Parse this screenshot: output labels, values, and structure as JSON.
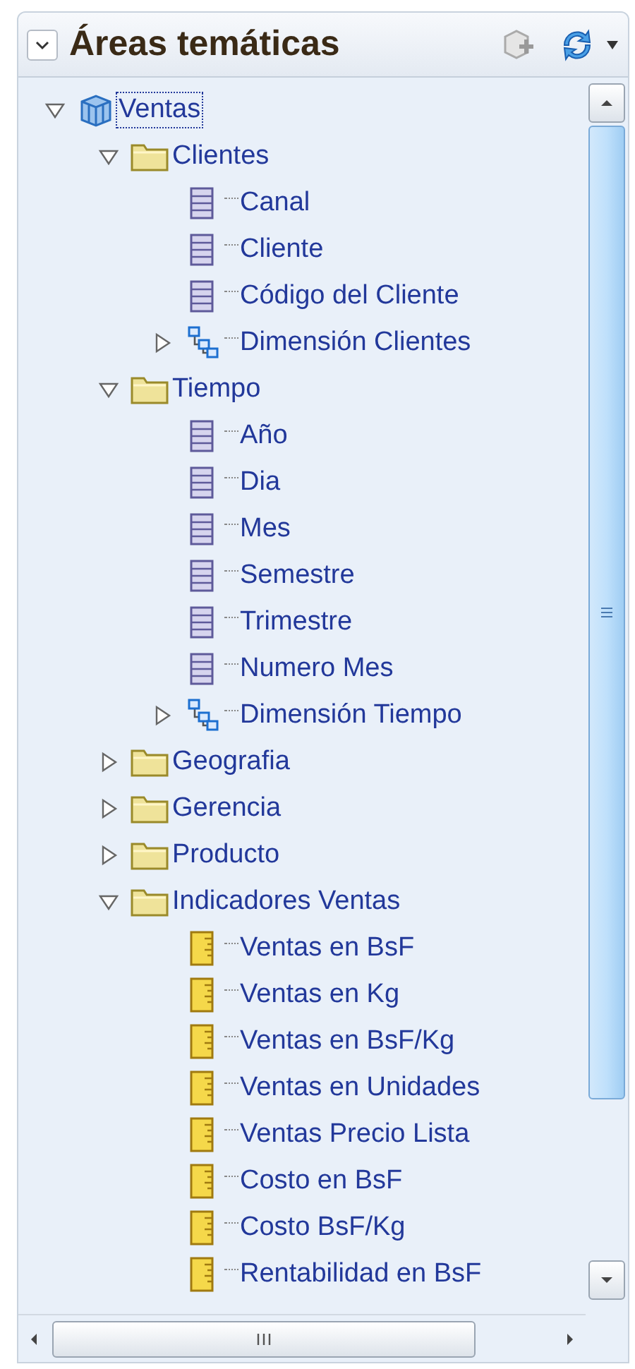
{
  "panel": {
    "title": "Áreas temáticas",
    "collapsed": false
  },
  "tree": [
    {
      "label": "Ventas",
      "kind": "subject",
      "selected": true,
      "expanded": true,
      "children": [
        {
          "label": "Clientes",
          "kind": "folder",
          "selected": false,
          "expanded": true,
          "children": [
            {
              "label": "Canal",
              "kind": "column",
              "selected": false
            },
            {
              "label": "Cliente",
              "kind": "column",
              "selected": false
            },
            {
              "label": "Código del Cliente",
              "kind": "column",
              "selected": false
            },
            {
              "label": "Dimensión Clientes",
              "kind": "hierarchy",
              "selected": false,
              "expanded": false
            }
          ]
        },
        {
          "label": "Tiempo",
          "kind": "folder",
          "selected": false,
          "expanded": true,
          "children": [
            {
              "label": "Año",
              "kind": "column",
              "selected": false
            },
            {
              "label": "Dia",
              "kind": "column",
              "selected": false
            },
            {
              "label": "Mes",
              "kind": "column",
              "selected": false
            },
            {
              "label": "Semestre",
              "kind": "column",
              "selected": false
            },
            {
              "label": "Trimestre",
              "kind": "column",
              "selected": false
            },
            {
              "label": "Numero Mes",
              "kind": "column",
              "selected": false
            },
            {
              "label": "Dimensión Tiempo",
              "kind": "hierarchy",
              "selected": false,
              "expanded": false
            }
          ]
        },
        {
          "label": "Geografia",
          "kind": "folder",
          "selected": false,
          "expanded": false
        },
        {
          "label": "Gerencia",
          "kind": "folder",
          "selected": false,
          "expanded": false
        },
        {
          "label": "Producto",
          "kind": "folder",
          "selected": false,
          "expanded": false
        },
        {
          "label": "Indicadores Ventas",
          "kind": "folder",
          "selected": false,
          "expanded": true,
          "children": [
            {
              "label": "Ventas en BsF",
              "kind": "measure",
              "selected": false
            },
            {
              "label": "Ventas en Kg",
              "kind": "measure",
              "selected": false
            },
            {
              "label": "Ventas en BsF/Kg",
              "kind": "measure",
              "selected": false
            },
            {
              "label": "Ventas en Unidades",
              "kind": "measure",
              "selected": false
            },
            {
              "label": "Ventas Precio Lista",
              "kind": "measure",
              "selected": false
            },
            {
              "label": "Costo en BsF",
              "kind": "measure",
              "selected": false
            },
            {
              "label": "Costo BsF/Kg",
              "kind": "measure",
              "selected": false
            },
            {
              "label": "Rentabilidad en BsF",
              "kind": "measure",
              "selected": false
            }
          ]
        }
      ]
    }
  ]
}
